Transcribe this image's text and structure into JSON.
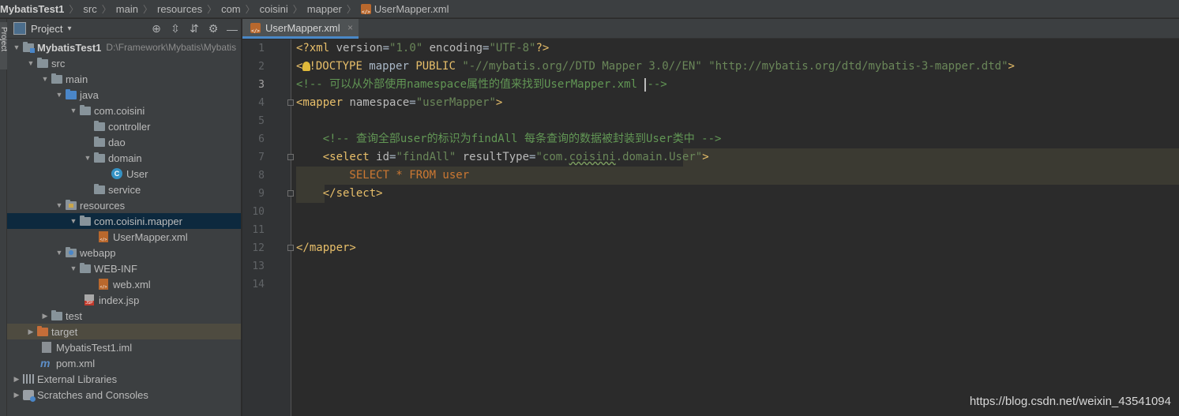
{
  "breadcrumb": {
    "items": [
      "MybatisTest1",
      "src",
      "main",
      "resources",
      "com",
      "coisini",
      "mapper"
    ],
    "file": "UserMapper.xml"
  },
  "tool_strip": {
    "label": "Project"
  },
  "project_panel": {
    "title": "Project",
    "dropdown": "▾",
    "tools": {
      "locate": "⊕",
      "expand": "⇳",
      "collapse": "⇵",
      "settings": "⚙",
      "hide": "—"
    },
    "tree": [
      {
        "label": "MybatisTest1",
        "hint": "D:\\Framework\\Mybatis\\Mybatis"
      },
      {
        "label": "src"
      },
      {
        "label": "main"
      },
      {
        "label": "java"
      },
      {
        "label": "com.coisini"
      },
      {
        "label": "controller"
      },
      {
        "label": "dao"
      },
      {
        "label": "domain"
      },
      {
        "label": "User"
      },
      {
        "label": "service"
      },
      {
        "label": "resources"
      },
      {
        "label": "com.coisini.mapper"
      },
      {
        "label": "UserMapper.xml"
      },
      {
        "label": "webapp"
      },
      {
        "label": "WEB-INF"
      },
      {
        "label": "web.xml"
      },
      {
        "label": "index.jsp"
      },
      {
        "label": "test"
      },
      {
        "label": "target"
      },
      {
        "label": "MybatisTest1.iml"
      },
      {
        "label": "pom.xml"
      },
      {
        "label": "External Libraries"
      },
      {
        "label": "Scratches and Consoles"
      }
    ]
  },
  "editor": {
    "tab_label": "UserMapper.xml",
    "tab_close": "×",
    "line_numbers": [
      "1",
      "2",
      "3",
      "4",
      "5",
      "6",
      "7",
      "8",
      "9",
      "10",
      "11",
      "12",
      "13",
      "14"
    ],
    "code": {
      "l1_a": "<?xml ",
      "l1_b": "version",
      "l1_c": "=",
      "l1_d": "\"1.0\"",
      "l1_e": " encoding",
      "l1_f": "=",
      "l1_g": "\"UTF-8\"",
      "l1_h": "?>",
      "l2_a": "<",
      "l2_b": "!DOCTYPE ",
      "l2_c": "mapper ",
      "l2_d": "PUBLIC ",
      "l2_e": "\"-//mybatis.org//DTD Mapper 3.0//EN\"",
      "l2_f": " ",
      "l2_g": "\"http://mybatis.org/dtd/mybatis-3-mapper.dtd\"",
      "l2_h": ">",
      "l3_a": "<!-- 可以从外部使用namespace属性的值来找到UserMapper.xml ",
      "l3_b": "-->",
      "l4_a": "<mapper ",
      "l4_b": "namespace",
      "l4_c": "=",
      "l4_d": "\"userMapper\"",
      "l4_e": ">",
      "l6_a": "    <!-- 查询全部user的标识为findAll 每条查询的数据被封装到User类中 -->",
      "l7_a": "    <select ",
      "l7_b": "id",
      "l7_c": "=",
      "l7_d": "\"findAll\"",
      "l7_e": " resultType",
      "l7_f": "=",
      "l7_g1": "\"com.",
      "l7_g2": "coisini",
      "l7_g3": ".domain.User\"",
      "l7_h": ">",
      "l8_a": "        SELECT * FROM user",
      "l9_a": "    </select>",
      "l12_a": "</mapper>"
    }
  },
  "watermark": "https://blog.csdn.net/weixin_43541094",
  "colors": {
    "background": "#2b2b2b",
    "panel": "#3c3f41",
    "selection": "#0d293e",
    "tag": "#e8bf6a",
    "string": "#6a8759",
    "comment": "#629755",
    "keyword": "#cc7832"
  }
}
